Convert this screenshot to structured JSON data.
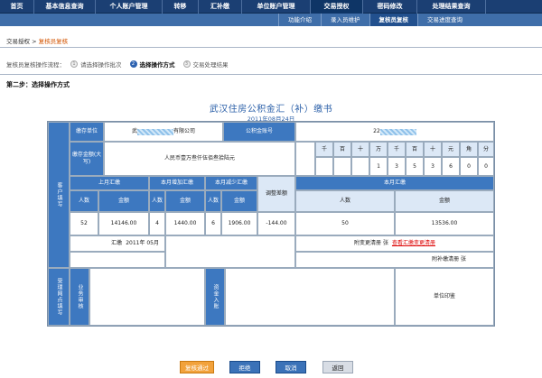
{
  "topnav": [
    "首页",
    "基本信息查询",
    "个人账户管理",
    "转移",
    "汇补缴",
    "单位账户管理",
    "交易授权",
    "密码修改",
    "处理结果查询"
  ],
  "subnav": [
    "功能介绍",
    "录入员维护",
    "复核员复核",
    "交易进度查询"
  ],
  "breadcrumb": {
    "root": "交易授权",
    "sep": " > ",
    "current": "复核员复核"
  },
  "flow": {
    "label": "复核员复核操作流程：",
    "steps": [
      {
        "num": "1",
        "text": "请选择操作批次"
      },
      {
        "num": "2",
        "text": "选择操作方式"
      },
      {
        "num": "3",
        "text": "交易处理结果"
      }
    ]
  },
  "step_title": "第二步：选择操作方式",
  "form": {
    "title": "武汉住房公积金汇（补）缴书",
    "date": "2011年08月24日",
    "left_label": "客户填写",
    "unit_label": "缴存单位",
    "unit_prefix": "武",
    "unit_suffix": "有限公司",
    "account_label": "公积金账号",
    "account_prefix": "22",
    "amount_label": "缴存金额(大写)",
    "amount_text": "人民币壹万叁仟伍佰叁拾陆元",
    "digit_headers": [
      "千",
      "百",
      "十",
      "万",
      "千",
      "百",
      "十",
      "元",
      "角",
      "分"
    ],
    "digits": [
      "",
      "",
      "",
      "1",
      "3",
      "5",
      "3",
      "6",
      "0",
      "0"
    ],
    "section_last": "上月汇缴",
    "section_add": "本月增加汇缴",
    "section_sub": "本月减少汇缴",
    "adjust": "调整差额",
    "section_this": "本月汇缴",
    "people": "人数",
    "amount": "金额",
    "v_last_people": "52",
    "v_last_amount": "14146.00",
    "v_add_people": "4",
    "v_add_amount": "1440.00",
    "v_sub_people": "6",
    "v_sub_amount": "1906.00",
    "v_adjust": "-144.00",
    "v_this_people": "50",
    "v_this_amount": "13536.00",
    "huijiao_label": "汇缴",
    "huijiao_value": "2011年 05月",
    "attach_change": "附变更清册  张",
    "attach_change_link": "查看汇缴变更清册",
    "attach_supp": "附补缴清册  张",
    "bottom_label": "受理网点填写",
    "review_label": "业务审核",
    "funds_label": "资金入账",
    "seal_label": "单位印鉴"
  },
  "buttons": [
    "复核通过",
    "拒绝",
    "取消",
    "返回"
  ]
}
